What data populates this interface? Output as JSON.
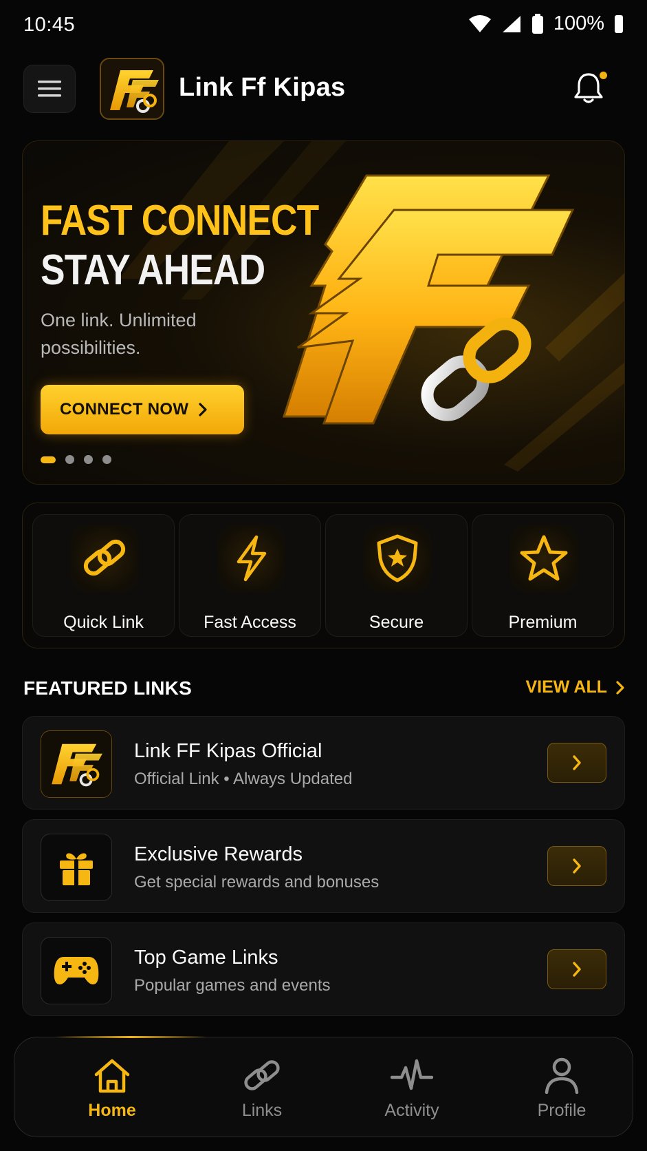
{
  "status_bar": {
    "time": "10:45",
    "battery": "100%",
    "icons": [
      "wifi-icon",
      "signal-icon",
      "battery-icon"
    ]
  },
  "header": {
    "app_title": "Link Ff Kipas",
    "menu_icon": "hamburger-icon",
    "notification_icon": "bell-icon",
    "has_notification": true
  },
  "hero": {
    "title_line1": "FAST CONNECT",
    "title_line2": "STAY AHEAD",
    "subtitle": "One link. Unlimited possibilities.",
    "cta_label": "CONNECT NOW",
    "slides_total": 4,
    "active_slide": 1
  },
  "quick_actions": [
    {
      "label": "Quick Link",
      "icon": "link-icon"
    },
    {
      "label": "Fast Access",
      "icon": "lightning-icon"
    },
    {
      "label": "Secure",
      "icon": "shield-icon"
    },
    {
      "label": "Premium",
      "icon": "star-icon"
    }
  ],
  "featured": {
    "title": "FEATURED LINKS",
    "view_all": "VIEW ALL",
    "items": [
      {
        "title": "Link FF Kipas Official",
        "subtitle": "Official Link • Always Updated",
        "icon": "ff-logo-icon"
      },
      {
        "title": "Exclusive Rewards",
        "subtitle": "Get special rewards and bonuses",
        "icon": "gift-icon"
      },
      {
        "title": "Top Game Links",
        "subtitle": "Popular games and events",
        "icon": "gamepad-icon"
      }
    ]
  },
  "bottom_nav": [
    {
      "label": "Home",
      "icon": "home-icon",
      "active": true
    },
    {
      "label": "Links",
      "icon": "link-icon",
      "active": false
    },
    {
      "label": "Activity",
      "icon": "activity-icon",
      "active": false
    },
    {
      "label": "Profile",
      "icon": "user-icon",
      "active": false
    }
  ],
  "colors": {
    "accent": "#f6b713",
    "background": "#060606",
    "card": "#111111",
    "muted_text": "#a9a9a9"
  }
}
